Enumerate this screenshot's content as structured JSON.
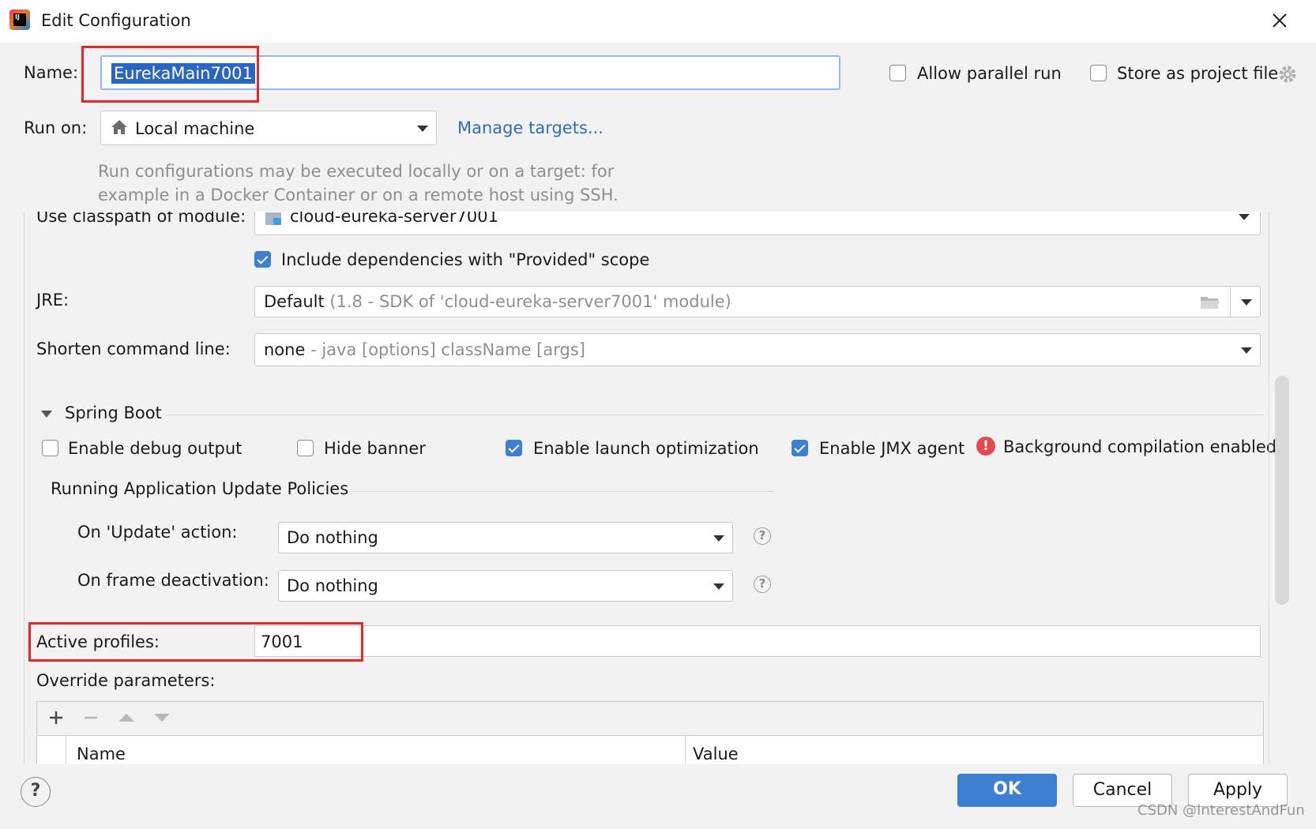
{
  "window": {
    "title": "Edit Configuration"
  },
  "name_field": {
    "label": "Name:",
    "value": "EurekaMain7001"
  },
  "options": {
    "allow_parallel_run": "Allow parallel run",
    "store_as_project_file": "Store as project file"
  },
  "run_on": {
    "label": "Run on:",
    "value": "Local machine",
    "manage_link": "Manage targets...",
    "hint_line1": "Run configurations may be executed locally or on a target: for",
    "hint_line2": "example in a Docker Container or on a remote host using SSH."
  },
  "classpath": {
    "label": "Use classpath of module:",
    "value": "cloud-eureka-server7001"
  },
  "include_deps": {
    "label": "Include dependencies with \"Provided\" scope",
    "checked": true
  },
  "jre": {
    "label": "JRE:",
    "value": "Default",
    "detail": "(1.8 - SDK of 'cloud-eureka-server7001' module)"
  },
  "shorten": {
    "label": "Shorten command line:",
    "value": "none",
    "detail": "- java [options] className [args]"
  },
  "spring_boot": {
    "section_title": "Spring Boot",
    "enable_debug_output": {
      "label": "Enable debug output",
      "checked": false
    },
    "hide_banner": {
      "label": "Hide banner",
      "checked": false
    },
    "enable_launch_optimization": {
      "label": "Enable launch optimization",
      "checked": true
    },
    "enable_jmx_agent": {
      "label": "Enable JMX agent",
      "checked": true
    },
    "background_compilation": "Background compilation enabled"
  },
  "update_policies": {
    "section_title": "Running Application Update Policies",
    "on_update": {
      "label": "On 'Update' action:",
      "value": "Do nothing"
    },
    "on_frame": {
      "label": "On frame deactivation:",
      "value": "Do nothing"
    }
  },
  "active_profiles": {
    "label": "Active profiles:",
    "value": "7001"
  },
  "override": {
    "label": "Override parameters:",
    "col_name": "Name",
    "col_value": "Value"
  },
  "footer": {
    "ok": "OK",
    "cancel": "Cancel",
    "apply": "Apply"
  },
  "watermark": "CSDN @InterestAndFun",
  "colors": {
    "accent": "#3d7fd1",
    "highlight_box": "#e8252a",
    "link": "#2f6db5",
    "error": "#e5484d"
  }
}
